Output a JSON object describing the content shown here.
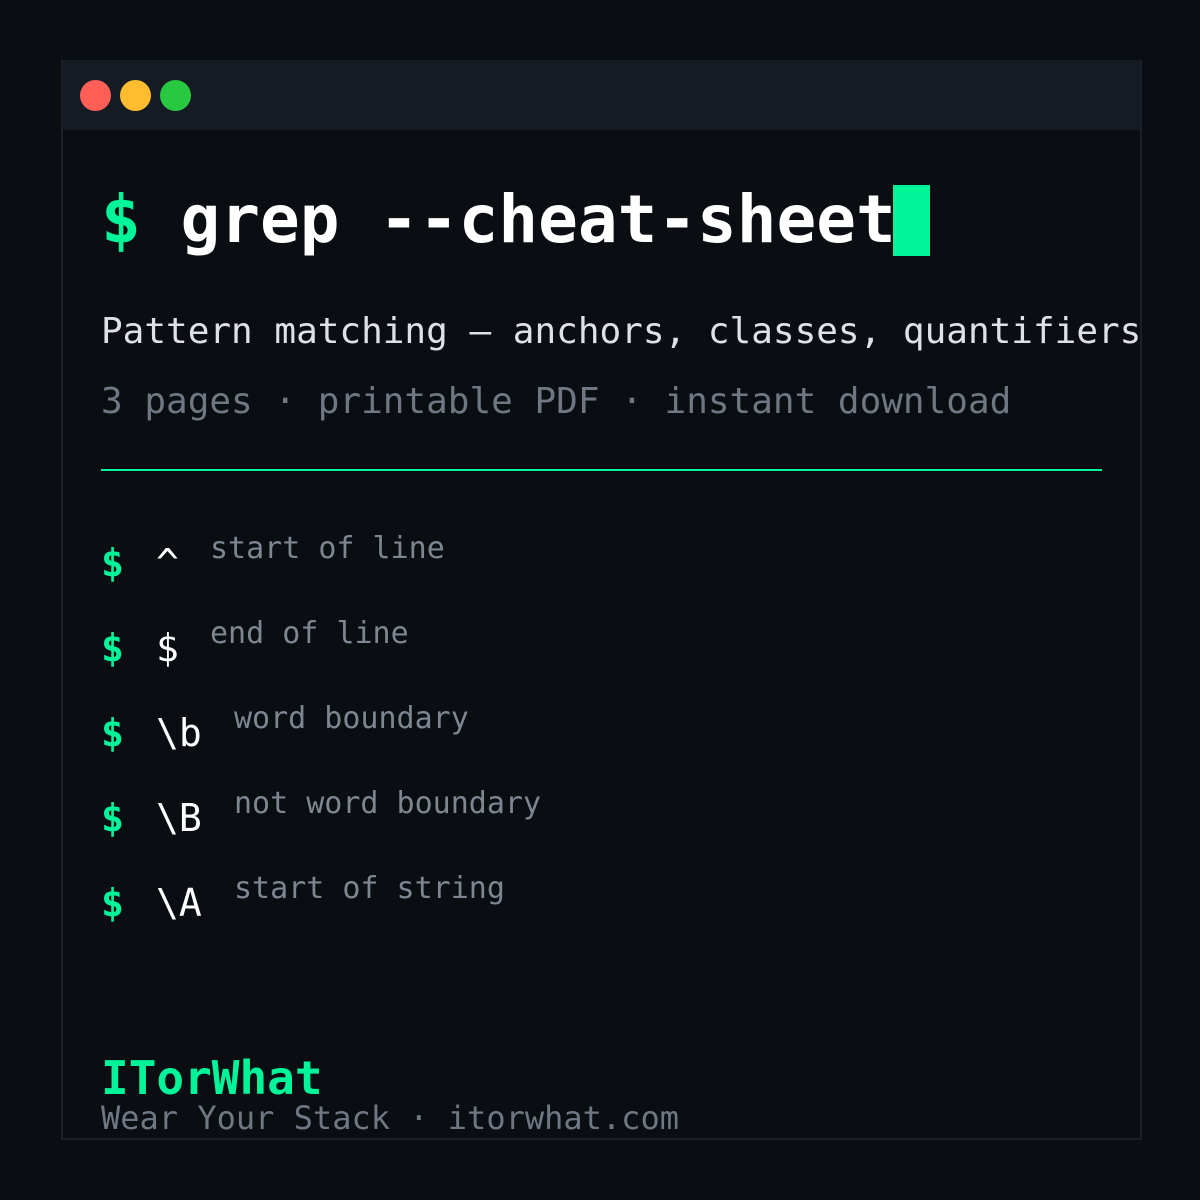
{
  "window": {
    "controls": [
      {
        "name": "close",
        "color": "#ff5f57"
      },
      {
        "name": "minimize",
        "color": "#febc2e"
      },
      {
        "name": "maximize",
        "color": "#28c840"
      }
    ]
  },
  "heading": {
    "prompt": "$",
    "command": "grep --cheat-sheet"
  },
  "subtitle": "Pattern matching — anchors, classes, quantifiers and more",
  "meta": "3 pages · printable PDF · instant download",
  "items": [
    {
      "prompt": "$",
      "token": "^",
      "desc": "start of line"
    },
    {
      "prompt": "$",
      "token": "$",
      "desc": "end of line"
    },
    {
      "prompt": "$",
      "token": "\\b",
      "desc": "word boundary"
    },
    {
      "prompt": "$",
      "token": "\\B",
      "desc": "not word boundary"
    },
    {
      "prompt": "$",
      "token": "\\A",
      "desc": "start of string"
    }
  ],
  "footer": {
    "brand": "ITorWhat",
    "tagline": "Wear Your Stack · itorwhat.com"
  },
  "colors": {
    "accent": "#00f59a",
    "background": "#0a0d11",
    "titlebar": "#151b22",
    "muted_text": "#6e7782"
  }
}
